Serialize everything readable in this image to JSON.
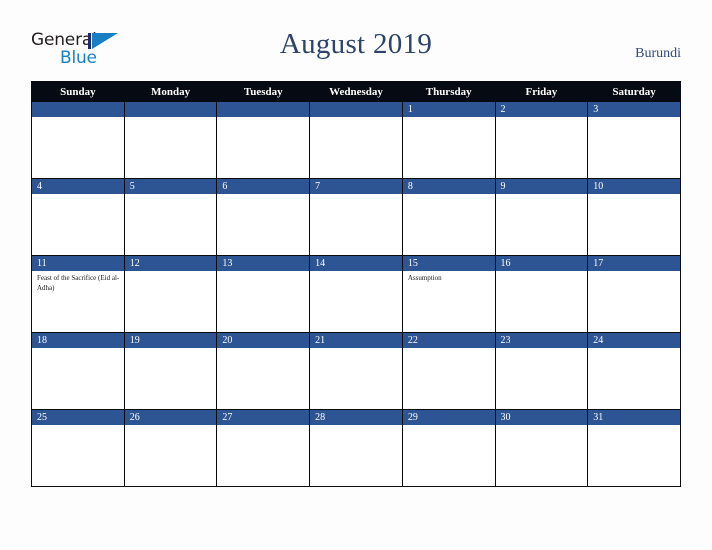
{
  "brand": {
    "word_one": "General",
    "word_two": "Blue",
    "logo_icon": "triangle-logo-icon",
    "accent_color": "#1a7fc1",
    "dark_color": "#1b2a6b"
  },
  "header": {
    "title": "August 2019",
    "country": "Burundi",
    "title_color": "#2e4369",
    "country_color": "#33497a"
  },
  "calendar": {
    "banner_color": "#2e5593",
    "header_bg": "#060a12",
    "weekdays": [
      "Sunday",
      "Monday",
      "Tuesday",
      "Wednesday",
      "Thursday",
      "Friday",
      "Saturday"
    ],
    "weeks": [
      [
        {
          "day": "",
          "events": []
        },
        {
          "day": "",
          "events": []
        },
        {
          "day": "",
          "events": []
        },
        {
          "day": "",
          "events": []
        },
        {
          "day": "1",
          "events": []
        },
        {
          "day": "2",
          "events": []
        },
        {
          "day": "3",
          "events": []
        }
      ],
      [
        {
          "day": "4",
          "events": []
        },
        {
          "day": "5",
          "events": []
        },
        {
          "day": "6",
          "events": []
        },
        {
          "day": "7",
          "events": []
        },
        {
          "day": "8",
          "events": []
        },
        {
          "day": "9",
          "events": []
        },
        {
          "day": "10",
          "events": []
        }
      ],
      [
        {
          "day": "11",
          "events": [
            "Feast of the Sacrifice (Eid al-Adha)"
          ]
        },
        {
          "day": "12",
          "events": []
        },
        {
          "day": "13",
          "events": []
        },
        {
          "day": "14",
          "events": []
        },
        {
          "day": "15",
          "events": [
            "Assumption"
          ]
        },
        {
          "day": "16",
          "events": []
        },
        {
          "day": "17",
          "events": []
        }
      ],
      [
        {
          "day": "18",
          "events": []
        },
        {
          "day": "19",
          "events": []
        },
        {
          "day": "20",
          "events": []
        },
        {
          "day": "21",
          "events": []
        },
        {
          "day": "22",
          "events": []
        },
        {
          "day": "23",
          "events": []
        },
        {
          "day": "24",
          "events": []
        }
      ],
      [
        {
          "day": "25",
          "events": []
        },
        {
          "day": "26",
          "events": []
        },
        {
          "day": "27",
          "events": []
        },
        {
          "day": "28",
          "events": []
        },
        {
          "day": "29",
          "events": []
        },
        {
          "day": "30",
          "events": []
        },
        {
          "day": "31",
          "events": []
        }
      ]
    ]
  }
}
